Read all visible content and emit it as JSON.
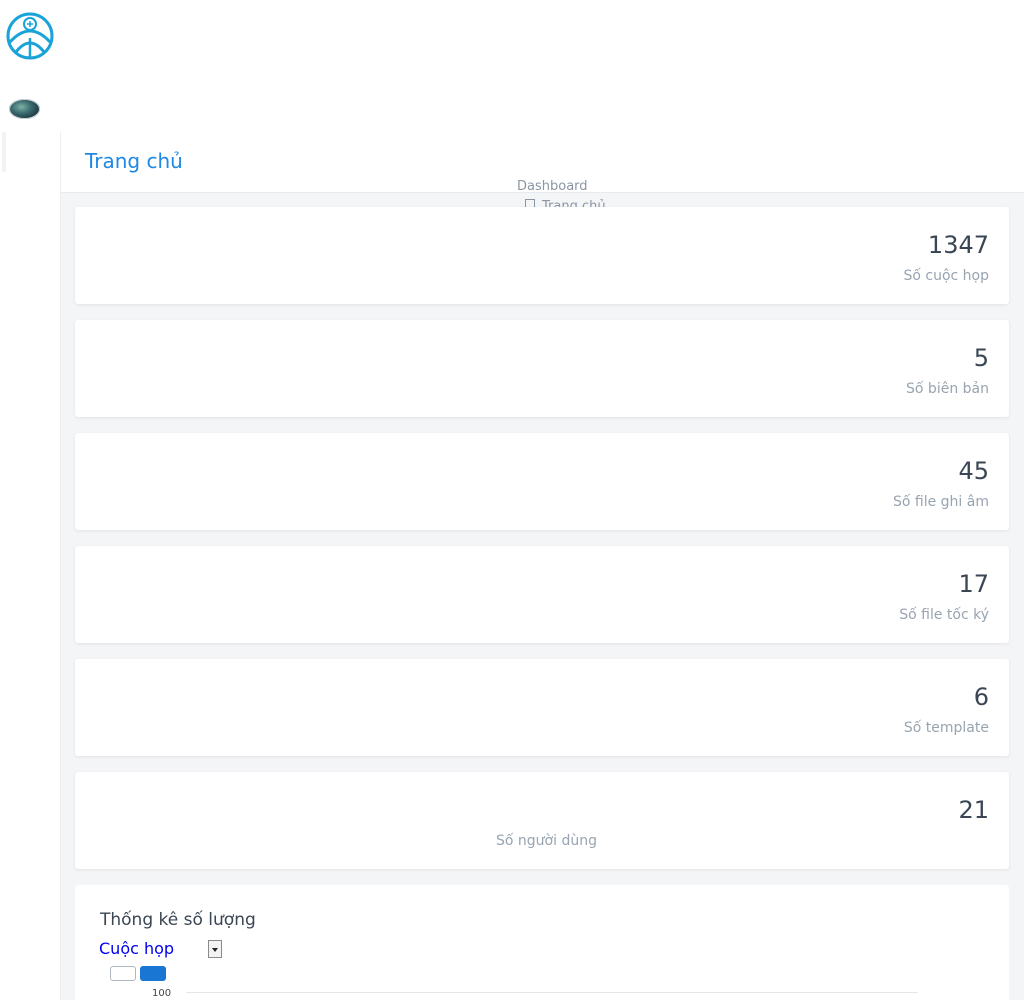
{
  "header": {
    "page_title": "Trang chủ",
    "breadcrumb": {
      "title": "Dashboard",
      "home": "Trang chủ"
    }
  },
  "stats": [
    {
      "value": "1347",
      "label": "Số cuộc họp"
    },
    {
      "value": "5",
      "label": "Số biên bản"
    },
    {
      "value": "45",
      "label": "Số file ghi âm"
    },
    {
      "value": "17",
      "label": "Số file tốc ký"
    },
    {
      "value": "6",
      "label": "Số template"
    },
    {
      "value": "21",
      "label": "Số người dùng"
    }
  ],
  "chart_section": {
    "title": "Thống kê số lượng",
    "selected": "Cuộc họp",
    "colors": {
      "series_1": "#ffffff",
      "series_2": "#1976d2"
    }
  },
  "chart_data": {
    "type": "bar",
    "y_tick_labels": [
      "100"
    ]
  },
  "colors": {
    "accent": "#1e88e5",
    "link": "#0000ee"
  }
}
